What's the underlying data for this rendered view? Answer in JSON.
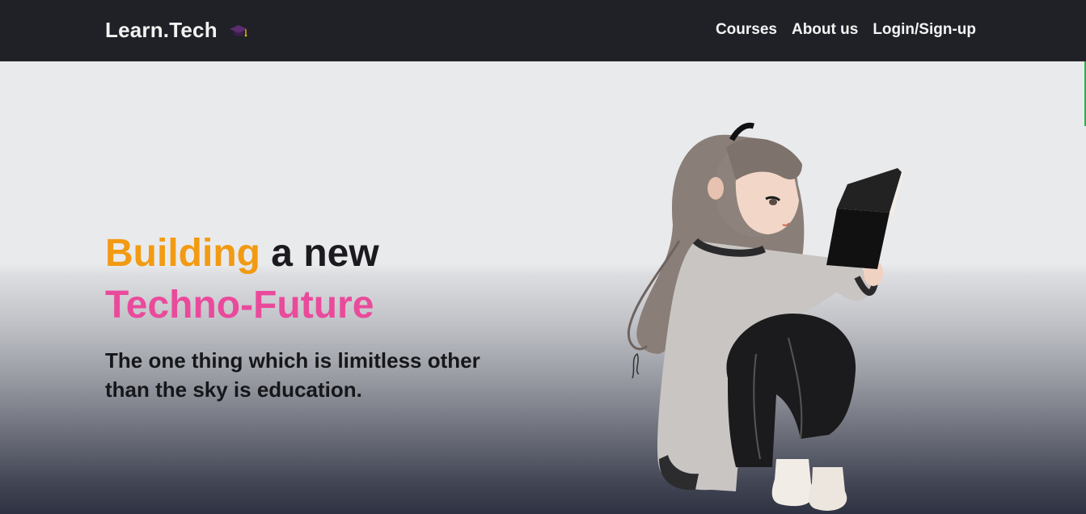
{
  "navbar": {
    "brand": "Learn.Tech",
    "brand_icon": "graduation-cap-icon",
    "links": [
      "Courses",
      "About us",
      "Login/Sign-up"
    ]
  },
  "hero": {
    "title_word1": "Building",
    "title_word2": " a new",
    "title_line2": "Techno-Future",
    "subtitle": "The one thing which is limitless other than the sky is education.",
    "illustration_icon": "girl-reading-book-illustration"
  },
  "colors": {
    "navbar_bg": "#1f2126",
    "accent_orange": "#f29a12",
    "accent_pink": "#ea4a9b",
    "text_dark": "#1b1b1f"
  }
}
